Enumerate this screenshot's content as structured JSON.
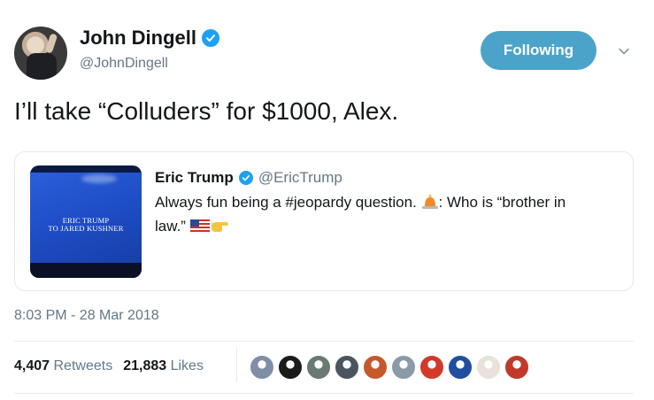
{
  "author": {
    "name": "John Dingell",
    "handle": "@JohnDingell",
    "verified": true
  },
  "follow_button": {
    "label": "Following",
    "color": "#4ba3c9"
  },
  "tweet": {
    "text": "I’ll take “Colluders” for $1000, Alex."
  },
  "quoted_tweet": {
    "name": "Eric Trump",
    "handle": "@EricTrump",
    "verified": true,
    "text_line1": "Always fun being a #jeopardy question.",
    "text_after_emoji": ": Who is “brother in",
    "text_line2": "law.”",
    "media_caption_line1": "ERIC TRUMP",
    "media_caption_line2": "TO JARED KUSHNER",
    "emojis": [
      "alarm-light-emoji",
      "us-flag-emoji",
      "pointing-hand-emoji"
    ]
  },
  "timestamp": "8:03 PM - 28 Mar 2018",
  "stats": {
    "retweets_count": "4,407",
    "retweets_label": "Retweets",
    "likes_count": "21,883",
    "likes_label": "Likes"
  },
  "likers": [
    {
      "icon": "liker-avatar-1",
      "color": "#7f8fa6"
    },
    {
      "icon": "liker-avatar-2",
      "color": "#1b1b1b"
    },
    {
      "icon": "liker-avatar-3",
      "color": "#6b7a70"
    },
    {
      "icon": "liker-avatar-4",
      "color": "#4a5560"
    },
    {
      "icon": "liker-avatar-5",
      "color": "#c4592e"
    },
    {
      "icon": "liker-avatar-6",
      "color": "#8a9aa8"
    },
    {
      "icon": "liker-avatar-7",
      "color": "#d23a2a"
    },
    {
      "icon": "liker-avatar-8",
      "color": "#1f4fa0"
    },
    {
      "icon": "liker-avatar-9",
      "color": "#e8e2da"
    },
    {
      "icon": "liker-avatar-10",
      "color": "#c0392b"
    }
  ],
  "colors": {
    "accent": "#1da1f2",
    "muted": "#657786",
    "text": "#14171a"
  }
}
